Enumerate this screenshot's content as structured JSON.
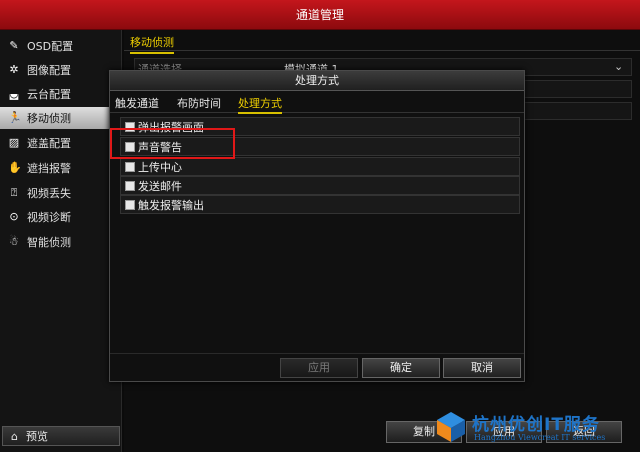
{
  "window": {
    "title": "通道管理"
  },
  "sidebar": {
    "items": [
      {
        "label": "OSD配置",
        "icon": "pencil-icon"
      },
      {
        "label": "图像配置",
        "icon": "aperture-icon"
      },
      {
        "label": "云台配置",
        "icon": "ptz-icon"
      },
      {
        "label": "移动侦测",
        "icon": "running-person-icon"
      },
      {
        "label": "遮盖配置",
        "icon": "mask-icon"
      },
      {
        "label": "遮挡报警",
        "icon": "hand-icon"
      },
      {
        "label": "视频丢失",
        "icon": "question-icon"
      },
      {
        "label": "视频诊断",
        "icon": "diagnosis-icon"
      },
      {
        "label": "智能侦测",
        "icon": "smart-person-icon"
      }
    ],
    "active_index": 3,
    "preview_label": "预览"
  },
  "main": {
    "tab_label": "移动侦测",
    "channel_label": "通道选择",
    "channel_value": "模拟通道 1",
    "buttons": {
      "copy": "复制",
      "apply": "应用",
      "back": "返回"
    }
  },
  "dialog": {
    "title": "处理方式",
    "tabs": [
      "触发通道",
      "布防时间",
      "处理方式"
    ],
    "active_tab": 2,
    "options": [
      {
        "label": "弹出报警画面",
        "checked": false
      },
      {
        "label": "声音警告",
        "checked": false
      },
      {
        "label": "上传中心",
        "checked": false
      },
      {
        "label": "发送邮件",
        "checked": false
      },
      {
        "label": "触发报警输出",
        "checked": false
      }
    ],
    "buttons": {
      "apply": "应用",
      "ok": "确定",
      "cancel": "取消"
    }
  },
  "watermark": {
    "text": "杭州优创IT服务",
    "subtitle": "Hangzhou Viewcreat IT services"
  },
  "colors": {
    "title_red": "#c4161c",
    "accent_yellow": "#f0d000",
    "highlight_red": "#e01818",
    "watermark_blue": "#1e74c8"
  }
}
